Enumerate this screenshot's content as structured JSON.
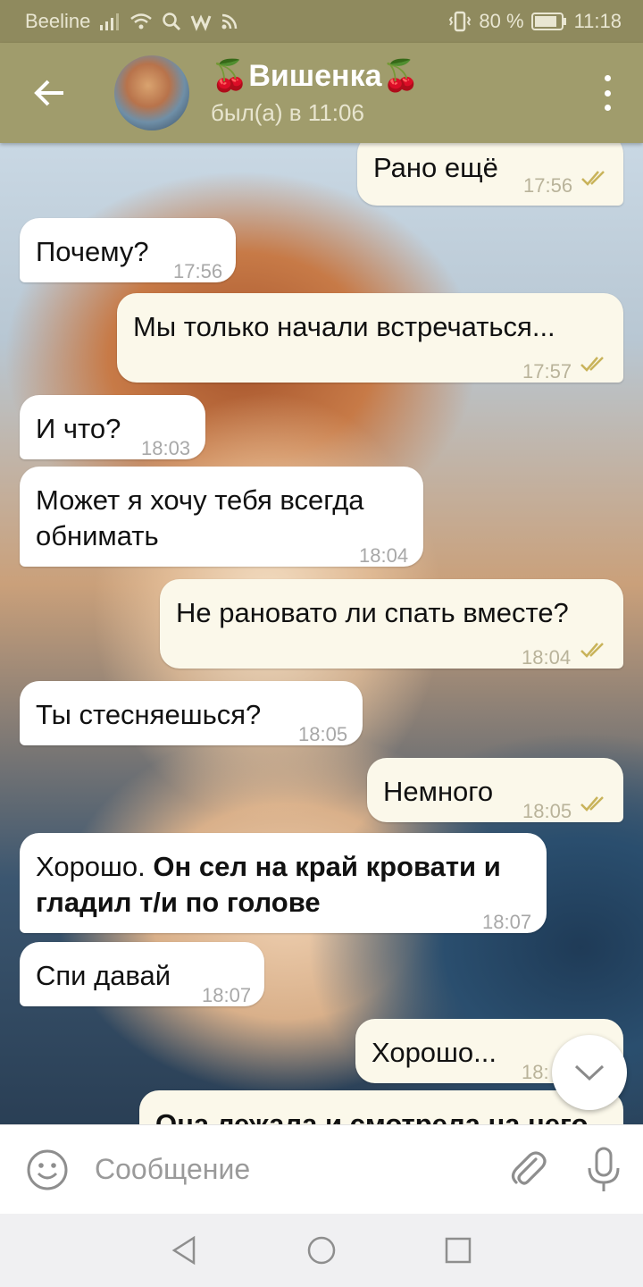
{
  "status_bar": {
    "carrier": "Beeline",
    "battery": "80 %",
    "time": "11:18"
  },
  "header": {
    "chat_name": "🍒Вишенка🍒",
    "last_seen": "был(а) в 11:06"
  },
  "messages": [
    {
      "dir": "out",
      "text": "Рано ещё",
      "time": "17:56",
      "read": true
    },
    {
      "dir": "in",
      "text": "Почему?",
      "time": "17:56"
    },
    {
      "dir": "out",
      "text": "Мы только начали встречаться...",
      "time": "17:57",
      "read": true
    },
    {
      "dir": "in",
      "text": "И что?",
      "time": "18:03"
    },
    {
      "dir": "in",
      "text_line1": "Может я хочу тебя всегда",
      "text_line2": "обнимать",
      "time": "18:04"
    },
    {
      "dir": "out",
      "text": "Не рановато ли спать вместе?",
      "time": "18:04",
      "read": true
    },
    {
      "dir": "in",
      "text": "Ты стесняешься?",
      "time": "18:05"
    },
    {
      "dir": "out",
      "text": "Немного",
      "time": "18:05",
      "read": true
    },
    {
      "dir": "in",
      "text_plain": "Хорошо. ",
      "text_bold_line1": "Он сел на край кровати и",
      "text_bold_line2": "гладил т/и по голове",
      "time": "18:07"
    },
    {
      "dir": "in",
      "text": "Спи давай",
      "time": "18:07"
    },
    {
      "dir": "out",
      "text": "Хорошо...",
      "time": "18:"
    },
    {
      "dir": "out",
      "text_bold": "Она лежала и смотрела на него"
    }
  ],
  "composer": {
    "placeholder": "Сообщение"
  },
  "icons": {
    "back": "arrow-left-icon",
    "menu": "more-vertical-icon",
    "emoji": "smiley-icon",
    "attach": "paperclip-icon",
    "mic": "microphone-icon",
    "scroll_down": "chevron-down-icon"
  },
  "colors": {
    "header": "#a09c6c",
    "status_bar": "#8f8a5e",
    "incoming_bubble": "#ffffff",
    "outgoing_bubble": "#fbf8ea",
    "read_check": "#c9b35a"
  }
}
